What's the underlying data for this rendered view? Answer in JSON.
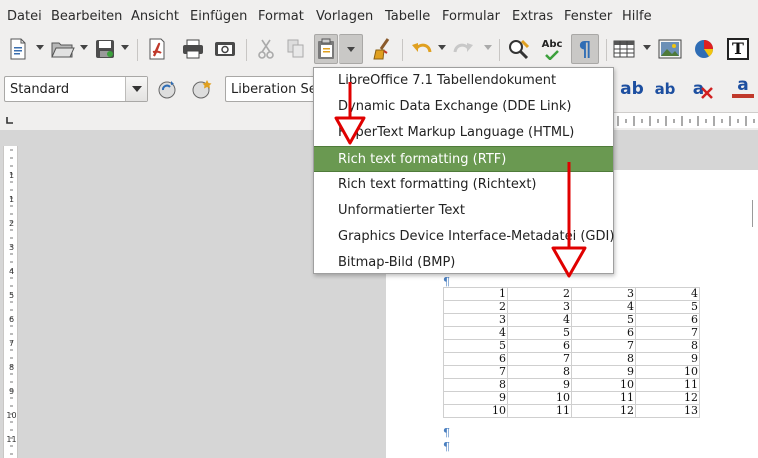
{
  "menubar": {
    "items": [
      "Datei",
      "Bearbeiten",
      "Ansicht",
      "Einfügen",
      "Format",
      "Vorlagen",
      "Tabelle",
      "Formular",
      "Extras",
      "Fenster",
      "Hilfe"
    ]
  },
  "toolbar1": {
    "icons": [
      "new-document-icon",
      "open-folder-icon",
      "save-icon",
      "export-pdf-icon",
      "print-icon",
      "print-preview-icon",
      "cut-icon",
      "copy-icon",
      "paste-icon",
      "clone-formatting-icon",
      "undo-icon",
      "redo-icon",
      "spellcheck-icon",
      "autocorrect-icon",
      "formatting-marks-icon",
      "table-icon",
      "image-icon",
      "chart-icon",
      "textbox-icon"
    ],
    "spellcheck_label": "Abc"
  },
  "toolbar2": {
    "paragraph_style": "Standard",
    "font_name": "Liberation Serif",
    "textbox_label": "T",
    "fontwork_labels": [
      "ab",
      "ab",
      "a",
      "a"
    ]
  },
  "paste_menu": {
    "options": [
      "LibreOffice 7.1 Tabellendokument",
      "Dynamic Data Exchange (DDE Link)",
      "HyperText Markup Language (HTML)",
      "Rich text formatting (RTF)",
      "Rich text formatting (Richtext)",
      "Unformatierter Text",
      "Graphics Device Interface-Metadatei (GDI)",
      "Bitmap-Bild (BMP)"
    ],
    "selected_index": 3
  },
  "ruler": {
    "v_numbers": [
      "1",
      "1",
      "2",
      "3",
      "4",
      "5",
      "6",
      "7",
      "8",
      "9",
      "10",
      "11",
      "12"
    ]
  },
  "table": {
    "rows": [
      [
        "1",
        "2",
        "3",
        "4"
      ],
      [
        "2",
        "3",
        "4",
        "5"
      ],
      [
        "3",
        "4",
        "5",
        "6"
      ],
      [
        "4",
        "5",
        "6",
        "7"
      ],
      [
        "5",
        "6",
        "7",
        "8"
      ],
      [
        "6",
        "7",
        "8",
        "9"
      ],
      [
        "7",
        "8",
        "9",
        "10"
      ],
      [
        "8",
        "9",
        "10",
        "11"
      ],
      [
        "9",
        "10",
        "11",
        "12"
      ],
      [
        "10",
        "11",
        "12",
        "13"
      ]
    ]
  },
  "pilcrow": "¶",
  "colors": {
    "chrome": "#f0efee",
    "workspace": "#d6d6d6",
    "selection": "#6a9951",
    "arrow": "#e00000"
  }
}
